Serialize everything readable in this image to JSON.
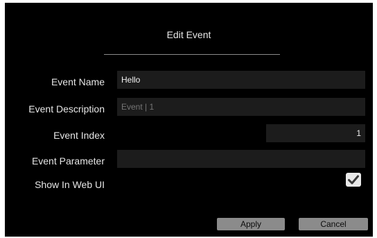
{
  "dialog": {
    "title": "Edit Event",
    "fields": {
      "name": {
        "label": "Event Name",
        "value": "Hello"
      },
      "description": {
        "label": "Event Description",
        "value": "",
        "placeholder": "Event | 1"
      },
      "index": {
        "label": "Event Index",
        "value": "1"
      },
      "parameter": {
        "label": "Event Parameter",
        "value": ""
      },
      "show_in_web_ui": {
        "label": "Show In Web UI",
        "checked": true
      }
    },
    "buttons": {
      "apply": "Apply",
      "cancel": "Cancel"
    }
  }
}
